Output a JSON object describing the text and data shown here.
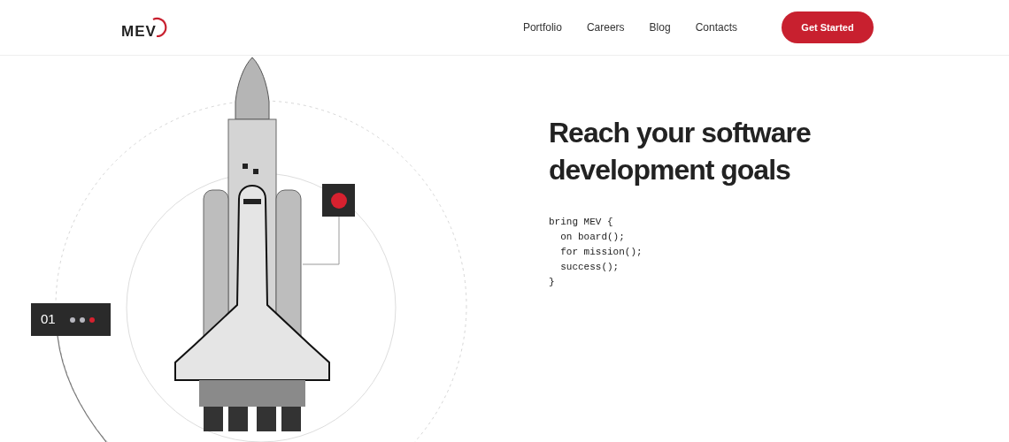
{
  "header": {
    "logo": "MEV",
    "nav": [
      {
        "label": "Portfolio"
      },
      {
        "label": "Careers"
      },
      {
        "label": "Blog"
      },
      {
        "label": "Contacts"
      }
    ],
    "cta": "Get Started"
  },
  "hero": {
    "heading_lines": [
      "Reach your software",
      "development goals"
    ],
    "code_lines": [
      "bring MEV {",
      "  on board();",
      "  for mission();",
      "  success();",
      "}"
    ]
  },
  "slider": {
    "number": "01",
    "dots": [
      {
        "selected": false
      },
      {
        "selected": false
      },
      {
        "selected": true
      }
    ]
  }
}
